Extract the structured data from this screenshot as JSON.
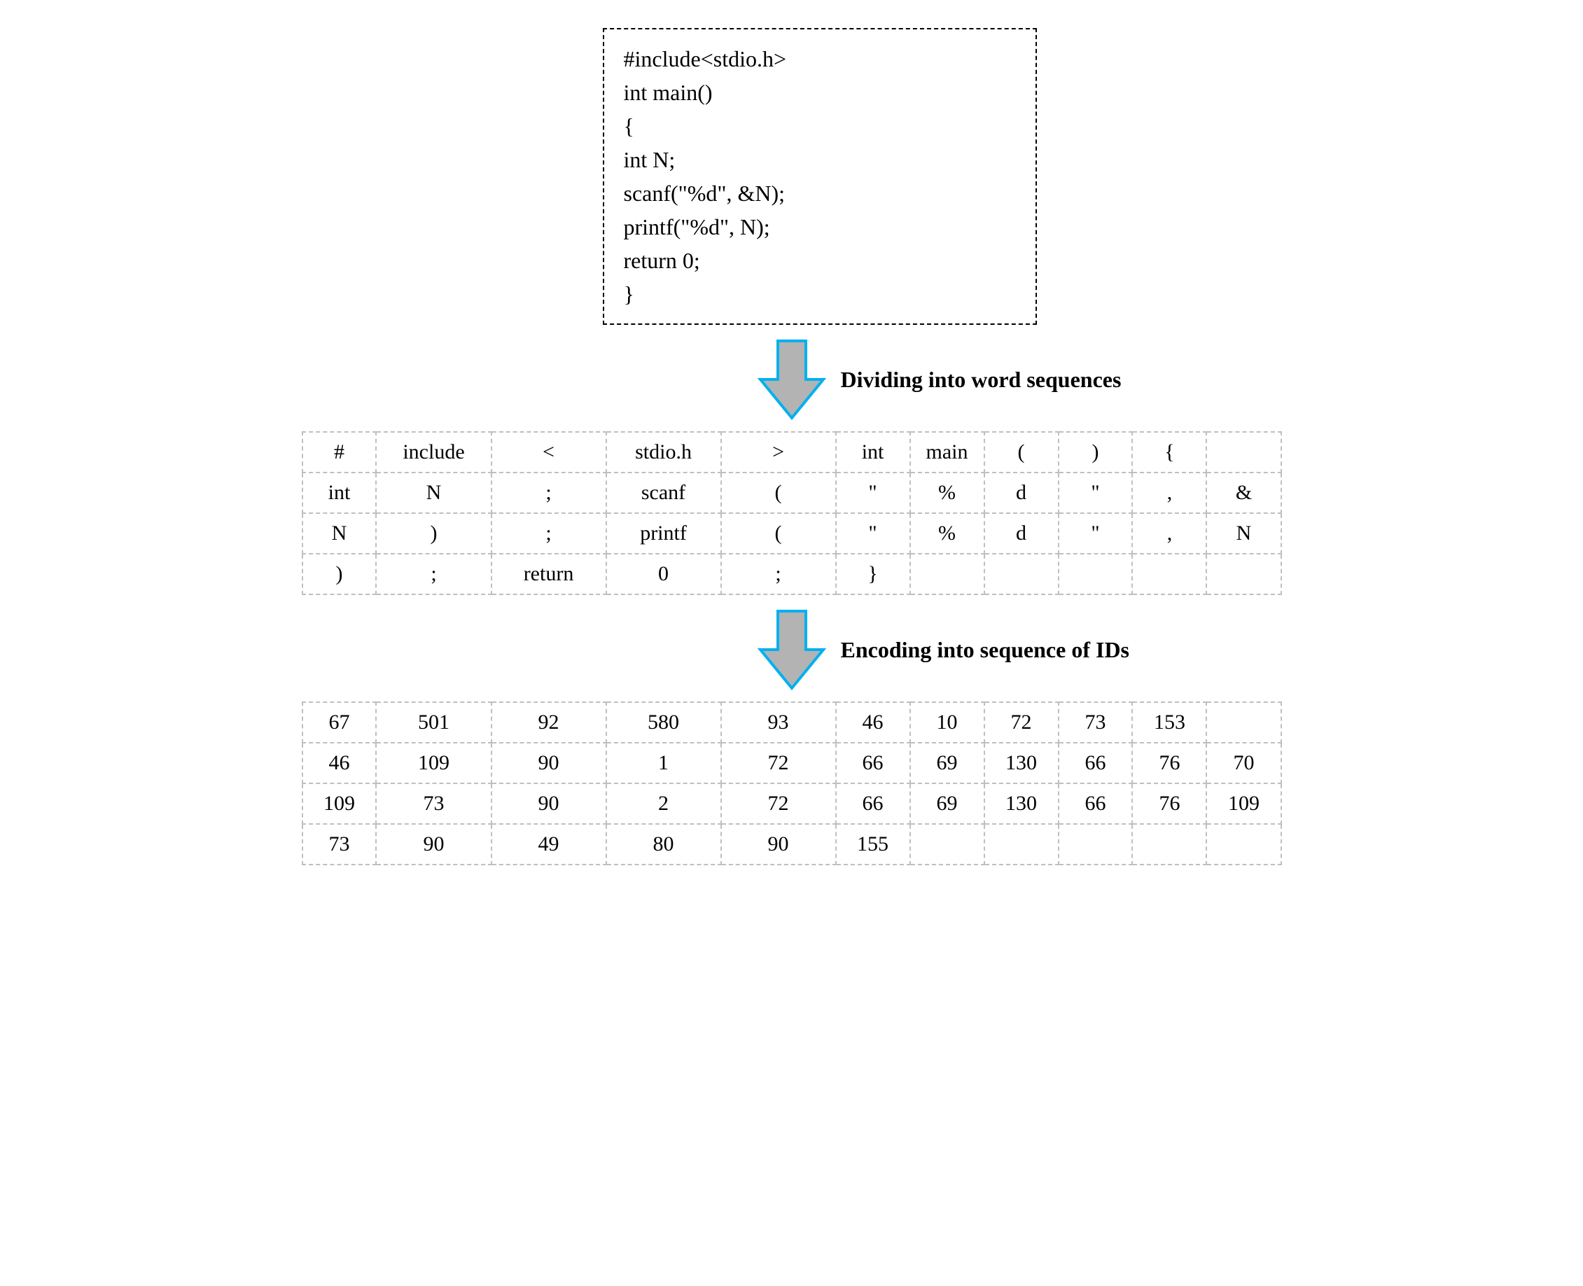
{
  "code": {
    "lines": [
      "#include<stdio.h>",
      "int main()",
      "{",
      "int N;",
      "scanf(\"%d\", &N);",
      "printf(\"%d\", N);",
      "return 0;",
      "}"
    ]
  },
  "arrow1_caption": "Dividing into word sequences",
  "arrow2_caption": "Encoding into sequence of IDs",
  "tokens": {
    "rows": [
      [
        "#",
        "include",
        "<",
        "stdio.h",
        ">",
        "int",
        "main",
        "(",
        ")",
        "{",
        ""
      ],
      [
        "int",
        "N",
        ";",
        "scanf",
        "(",
        "\"",
        "%",
        "d",
        "\"",
        ",",
        "&"
      ],
      [
        "N",
        ")",
        ";",
        "printf",
        "(",
        "\"",
        "%",
        "d",
        "\"",
        ",",
        "N"
      ],
      [
        ")",
        ";",
        "return",
        "0",
        ";",
        "}",
        "",
        "",
        "",
        "",
        ""
      ]
    ]
  },
  "ids": {
    "rows": [
      [
        "67",
        "501",
        "92",
        "580",
        "93",
        "46",
        "10",
        "72",
        "73",
        "153",
        ""
      ],
      [
        "46",
        "109",
        "90",
        "1",
        "72",
        "66",
        "69",
        "130",
        "66",
        "76",
        "70"
      ],
      [
        "109",
        "73",
        "90",
        "2",
        "72",
        "66",
        "69",
        "130",
        "66",
        "76",
        "109"
      ],
      [
        "73",
        "90",
        "49",
        "80",
        "90",
        "155",
        "",
        "",
        "",
        "",
        ""
      ]
    ]
  }
}
